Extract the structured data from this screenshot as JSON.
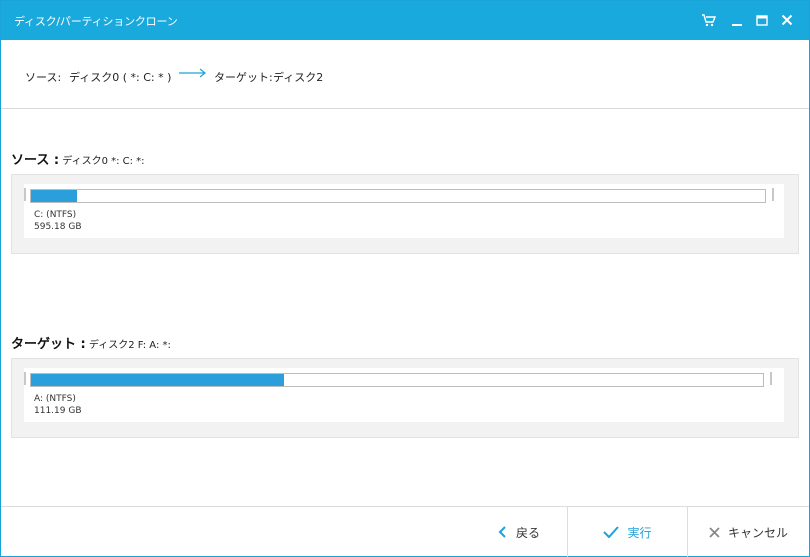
{
  "window": {
    "title": "ディスク/パーティションクローン"
  },
  "titlebar_icons": [
    "cart-icon",
    "minimize-icon",
    "maximize-icon",
    "close-icon"
  ],
  "path": {
    "source_label": "ソース:",
    "source_value": "ディスク0 ( *: C: * )",
    "target_label": "ターゲット:",
    "target_value": "ディスク2"
  },
  "source": {
    "label": "ソース :",
    "detail": "ディスク0 *: C: *:",
    "partition_name": "C: (NTFS)",
    "partition_size": "595.18 GB",
    "used_fraction": 0.062
  },
  "target": {
    "label": "ターゲット :",
    "detail": "ディスク2 F: A: *:",
    "partition_name": "A: (NTFS)",
    "partition_size": "111.19 GB",
    "used_fraction": 0.346
  },
  "footer": {
    "back_label": "戻る",
    "execute_label": "実行",
    "cancel_label": "キャンセル"
  },
  "colors": {
    "accent": "#1aa9dc",
    "bar_fill": "#2b9fdc"
  }
}
